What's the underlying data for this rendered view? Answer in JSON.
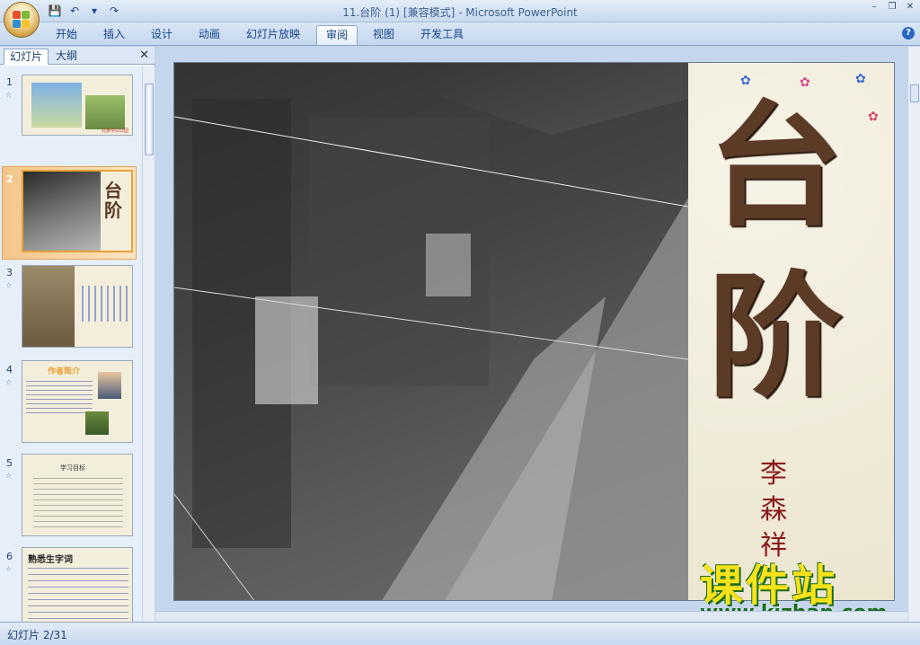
{
  "window": {
    "title": "11.台阶 (1) [兼容模式] - Microsoft PowerPoint",
    "controls": [
      "–",
      "❐",
      "✕"
    ]
  },
  "qat": {
    "save_icon": "💾",
    "undo_icon": "↶",
    "redo_icon": "↷",
    "more": "▾"
  },
  "ribbon": {
    "tabs": [
      "开始",
      "插入",
      "设计",
      "动画",
      "幻灯片放映",
      "审阅",
      "视图",
      "开发工具"
    ],
    "active_tab": "审阅",
    "help": "?"
  },
  "pane": {
    "tabs": [
      "幻灯片",
      "大纲"
    ],
    "close": "✕",
    "slides": [
      {
        "num": "1",
        "caption": "北京中山公园"
      },
      {
        "num": "2",
        "caption": "台阶"
      },
      {
        "num": "3",
        "caption": ""
      },
      {
        "num": "4",
        "caption": "作者简介"
      },
      {
        "num": "5",
        "caption": "学习目标"
      },
      {
        "num": "6",
        "caption": "熟悉生字词"
      }
    ]
  },
  "slide": {
    "title_1": "台",
    "title_2": "阶",
    "author": [
      "李",
      "森",
      "祥"
    ]
  },
  "watermark": {
    "line1": "课件站",
    "line2": "www.kjzhan.com"
  },
  "status": {
    "text": "幻灯片 2/31"
  },
  "colors": {
    "accent": "#e9a235",
    "title": "#5b3a26",
    "author": "#8b1a1a",
    "watermark_yellow": "#f7e21b",
    "watermark_green": "#1a6b1a"
  }
}
